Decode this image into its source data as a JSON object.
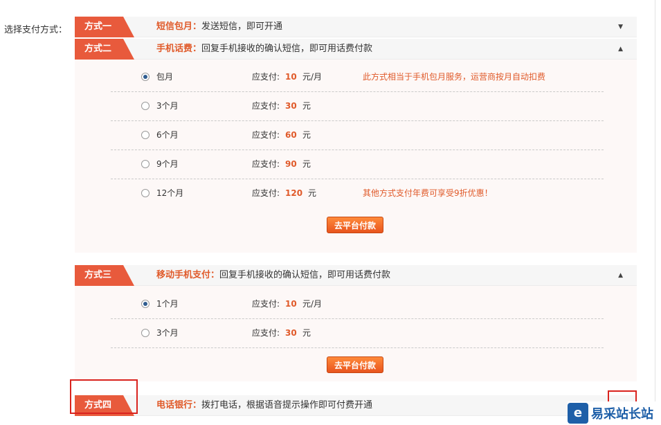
{
  "pay_label": "选择支付方式：",
  "sections": [
    {
      "tag": "方式一",
      "title_strong": "短信包月：",
      "title_desc": "发送短信，即可开通",
      "arrow": "▼"
    },
    {
      "tag": "方式二",
      "title_strong": "手机话费：",
      "title_desc": "回复手机接收的确认短信，即可用话费付款",
      "arrow": "▲",
      "options": [
        {
          "period": "包月",
          "due_label": "应支付:",
          "amount": "10",
          "unit": "元/月",
          "note": "此方式相当于手机包月服务，运营商按月自动扣费",
          "checked": true
        },
        {
          "period": "3个月",
          "due_label": "应支付:",
          "amount": "30",
          "unit": "元",
          "note": ""
        },
        {
          "period": "6个月",
          "due_label": "应支付:",
          "amount": "60",
          "unit": "元",
          "note": ""
        },
        {
          "period": "9个月",
          "due_label": "应支付:",
          "amount": "90",
          "unit": "元",
          "note": ""
        },
        {
          "period": "12个月",
          "due_label": "应支付:",
          "amount": "120",
          "unit": "元",
          "note": "其他方式支付年费可享受9折优惠！"
        }
      ],
      "pay_button": "去平台付款"
    },
    {
      "tag": "方式三",
      "title_strong": "移动手机支付：",
      "title_desc": "回复手机接收的确认短信，即可用话费付款",
      "arrow": "▲",
      "options": [
        {
          "period": "1个月",
          "due_label": "应支付:",
          "amount": "10",
          "unit": "元/月",
          "checked": true
        },
        {
          "period": "3个月",
          "due_label": "应支付:",
          "amount": "30",
          "unit": "元"
        }
      ],
      "pay_button": "去平台付款"
    },
    {
      "tag": "方式四",
      "title_strong": "电话银行：",
      "title_desc": "拨打电话，根据语音提示操作即可付费开通",
      "arrow": "▼"
    }
  ],
  "logo": {
    "icon": "e",
    "text": "易采站长站"
  },
  "colors": {
    "accent": "#e85a3c",
    "highlight": "#d9231e",
    "brand": "#1e5fa8"
  }
}
